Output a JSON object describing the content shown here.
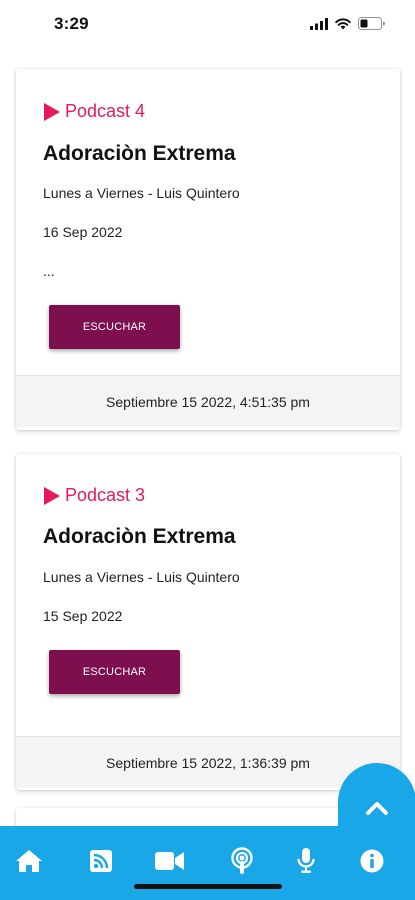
{
  "status": {
    "time": "3:29",
    "signal_icon": "cellular-signal-icon",
    "wifi_icon": "wifi-icon",
    "battery_icon": "battery-icon"
  },
  "podcasts": [
    {
      "tag": "Podcast 4",
      "title": "Adoraciòn Extrema",
      "schedule": "Lunes a Viernes - Luis Quintero",
      "date": "16 Sep 2022",
      "excerpt": "...",
      "button_label": "ESCUCHAR",
      "published": "Septiembre 15 2022, 4:51:35 pm"
    },
    {
      "tag": "Podcast 3",
      "title": "Adoraciòn Extrema",
      "schedule": "Lunes a Viernes - Luis Quintero",
      "date": "15 Sep 2022",
      "button_label": "ESCUCHAR",
      "published": "Septiembre 15 2022, 1:36:39 pm"
    }
  ],
  "nav": {
    "items": [
      "home-icon",
      "rss-feed-icon",
      "video-camera-icon",
      "podcast-icon",
      "microphone-icon",
      "info-icon"
    ],
    "scroll_top_icon": "chevron-up-icon"
  },
  "colors": {
    "accent": "#e5195f",
    "button": "#7e0f4f",
    "nav_bar": "#1aa7e8"
  }
}
